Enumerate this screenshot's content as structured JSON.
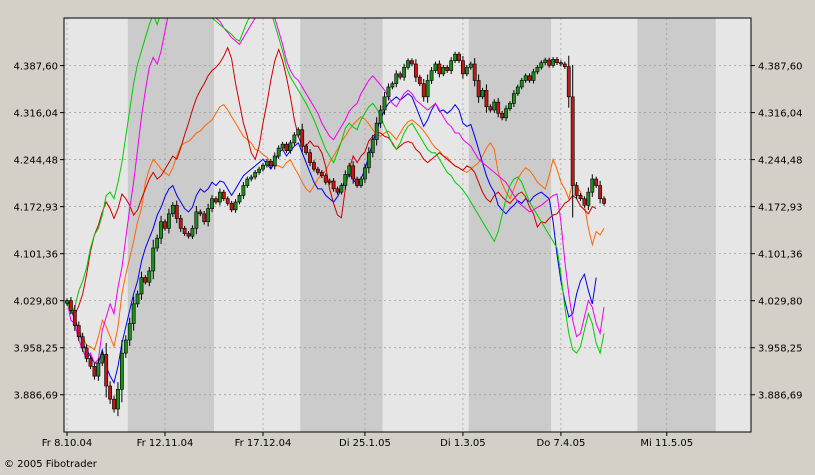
{
  "chart_data": {
    "type": "candlestick",
    "title": "",
    "copyright": "© 2005 Fibotrader",
    "ylim": [
      3830,
      4460
    ],
    "y_ticks": [
      3886.69,
      3958.25,
      4029.8,
      4101.36,
      4172.93,
      4244.48,
      4316.04,
      4387.6
    ],
    "y_tick_labels": [
      "3.886,69",
      "3.958,25",
      "4.029,80",
      "4.101,36",
      "4.172,93",
      "4.244,48",
      "4.316,04",
      "4.387,60"
    ],
    "x_range": [
      0,
      165
    ],
    "x_ticks": [
      {
        "label": "Fr 8.10.04",
        "i": 0
      },
      {
        "label": "Fr 12.11.04",
        "i": 25
      },
      {
        "label": "Fr 17.12.04",
        "i": 50
      },
      {
        "label": "Di 25.1.05",
        "i": 76
      },
      {
        "label": "Di 1.3.05",
        "i": 101
      },
      {
        "label": "Do 7.4.05",
        "i": 126
      },
      {
        "label": "Mi 11.5.05",
        "i": 153
      }
    ],
    "shaded_bands": [
      [
        16,
        38
      ],
      [
        60,
        81
      ],
      [
        103,
        124
      ],
      [
        146,
        166
      ]
    ],
    "up_color": "#1e8c1e",
    "down_color": "#c81414",
    "candles_close": [
      4030,
      4015,
      3992,
      3975,
      3958,
      3942,
      3930,
      3915,
      3935,
      3948,
      3900,
      3880,
      3865,
      3895,
      3950,
      3970,
      3995,
      4025,
      4040,
      4065,
      4058,
      4075,
      4110,
      4125,
      4150,
      4140,
      4162,
      4175,
      4155,
      4140,
      4132,
      4128,
      4140,
      4165,
      4162,
      4150,
      4170,
      4185,
      4180,
      4195,
      4185,
      4178,
      4168,
      4180,
      4190,
      4205,
      4215,
      4218,
      4225,
      4230,
      4236,
      4242,
      4235,
      4250,
      4262,
      4268,
      4258,
      4270,
      4282,
      4290,
      4265,
      4255,
      4240,
      4230,
      4225,
      4220,
      4210,
      4212,
      4200,
      4195,
      4205,
      4222,
      4235,
      4215,
      4205,
      4215,
      4232,
      4255,
      4275,
      4300,
      4320,
      4340,
      4355,
      4360,
      4375,
      4370,
      4385,
      4395,
      4390,
      4370,
      4360,
      4340,
      4365,
      4380,
      4390,
      4375,
      4385,
      4380,
      4395,
      4405,
      4395,
      4375,
      4385,
      4390,
      4365,
      4340,
      4350,
      4325,
      4320,
      4332,
      4315,
      4308,
      4322,
      4330,
      4345,
      4355,
      4365,
      4372,
      4365,
      4378,
      4385,
      4392,
      4396,
      4388,
      4397,
      4392,
      4390,
      4386,
      4340,
      4205,
      4190,
      4185,
      4175,
      4195,
      4215,
      4205,
      4185,
      4178
    ],
    "series": [
      {
        "color": "#ff6600",
        "values": [
          4030,
          4020,
          4005,
          3985,
          3975,
          3962,
          3960,
          3955,
          3975,
          4000,
          3990,
          3975,
          3960,
          3990,
          4040,
          4070,
          4095,
          4120,
          4150,
          4170,
          4210,
          4230,
          4245,
          4238,
          4230,
          4225,
          4220,
          4232,
          4250,
          4265,
          4270,
          4272,
          4278,
          4285,
          4288,
          4295,
          4300,
          4305,
          4315,
          4325,
          4328,
          4320,
          4310,
          4300,
          4290,
          4280,
          4275,
          4270,
          4260,
          4258,
          4252,
          4248,
          4240,
          4235,
          4235,
          4232,
          4240,
          4244,
          4232,
          4222,
          4210,
          4200,
          4195,
          4205,
          4215,
          4222,
          4228,
          4240,
          4250,
          4260,
          4272,
          4280,
          4290,
          4298,
          4304,
          4310,
          4306,
          4299,
          4290,
          4283,
          4280,
          4285,
          4288,
          4282,
          4275,
          4285,
          4295,
          4302,
          4305,
          4300,
          4295,
          4288,
          4280,
          4270,
          4262,
          4258,
          4250,
          4248,
          4240,
          4235,
          4232,
          4228,
          4225,
          4230,
          4235,
          4240,
          4250,
          4262,
          4270,
          4260,
          4225,
          4208,
          4195,
          4185,
          4200,
          4215,
          4225,
          4232,
          4228,
          4220,
          4210,
          4205,
          4200,
          4220,
          4245,
          4230,
          4210,
          4200,
          4185,
          4210,
          4205,
          4195,
          4175,
          4140,
          4115,
          4135,
          4130,
          4140
        ]
      },
      {
        "color": "#0000ee",
        "values": [
          4030,
          4018,
          4000,
          3985,
          3965,
          3955,
          3945,
          3935,
          3935,
          3955,
          3930,
          3915,
          3905,
          3930,
          3965,
          3990,
          4015,
          4040,
          4060,
          4090,
          4110,
          4125,
          4140,
          4160,
          4172,
          4188,
          4200,
          4205,
          4190,
          4180,
          4170,
          4165,
          4172,
          4190,
          4200,
          4195,
          4200,
          4210,
          4205,
          4212,
          4210,
          4200,
          4190,
          4200,
          4210,
          4220,
          4225,
          4230,
          4235,
          4240,
          4245,
          4238,
          4230,
          4240,
          4255,
          4260,
          4250,
          4258,
          4265,
          4270,
          4255,
          4240,
          4225,
          4210,
          4200,
          4200,
          4190,
          4185,
          4180,
          4188,
          4200,
          4215,
          4222,
          4215,
          4205,
          4215,
          4230,
          4250,
          4270,
          4290,
          4305,
          4320,
          4330,
          4335,
          4340,
          4335,
          4340,
          4345,
          4340,
          4325,
          4310,
          4295,
          4305,
          4320,
          4330,
          4318,
          4320,
          4315,
          4320,
          4328,
          4320,
          4300,
          4295,
          4298,
          4280,
          4260,
          4240,
          4220,
          4205,
          4195,
          4175,
          4168,
          4162,
          4170,
          4175,
          4182,
          4178,
          4185,
          4180,
          4188,
          4192,
          4195,
          4190,
          4185,
          4150,
          4100,
          4060,
          4030,
          4005,
          4010,
          4040,
          4060,
          4070,
          4045,
          4025,
          4065
        ]
      },
      {
        "color": "#cc0000",
        "values": [
          4030,
          4015,
          4008,
          4022,
          4040,
          4070,
          4105,
          4130,
          4145,
          4165,
          4180,
          4170,
          4155,
          4170,
          4192,
          4185,
          4175,
          4160,
          4168,
          4185,
          4200,
          4215,
          4225,
          4215,
          4220,
          4230,
          4240,
          4250,
          4245,
          4262,
          4282,
          4300,
          4320,
          4338,
          4350,
          4360,
          4372,
          4380,
          4385,
          4392,
          4402,
          4415,
          4398,
          4360,
          4330,
          4300,
          4280,
          4255,
          4245,
          4265,
          4300,
          4330,
          4365,
          4395,
          4412,
          4395,
          4370,
          4340,
          4305,
          4280,
          4265,
          4265,
          4273,
          4265,
          4265,
          4255,
          4234,
          4200,
          4178,
          4160,
          4156,
          4200,
          4230,
          4250,
          4240,
          4250,
          4256,
          4273,
          4280,
          4286,
          4285,
          4280,
          4278,
          4270,
          4260,
          4265,
          4270,
          4272,
          4270,
          4260,
          4255,
          4245,
          4240,
          4245,
          4250,
          4255,
          4250,
          4245,
          4240,
          4235,
          4232,
          4228,
          4235,
          4232,
          4225,
          4210,
          4195,
          4185,
          4180,
          4190,
          4195,
          4188,
          4182,
          4178,
          4185,
          4192,
          4195,
          4188,
          4172,
          4162,
          4142,
          4150,
          4148,
          4155,
          4160,
          4162,
          4170,
          4178,
          4182,
          4190,
          4185,
          4174,
          4168,
          4162,
          4173,
          4170
        ]
      },
      {
        "color": "#ee00ee",
        "values": [
          4030,
          4000,
          3995,
          3970,
          3955,
          3940,
          3950,
          3935,
          3940,
          3985,
          4005,
          4025,
          4010,
          4050,
          4080,
          4125,
          4170,
          4210,
          4260,
          4310,
          4350,
          4385,
          4400,
          4390,
          4410,
          4440,
          4470,
          4495,
          4505,
          4500,
          4515,
          4510,
          4490,
          4475,
          4478,
          4470,
          4465,
          4472,
          4460,
          4455,
          4445,
          4438,
          4430,
          4425,
          4420,
          4430,
          4440,
          4450,
          4460,
          4470,
          4478,
          4480,
          4475,
          4460,
          4440,
          4420,
          4395,
          4380,
          4370,
          4365,
          4355,
          4345,
          4335,
          4325,
          4315,
          4300,
          4290,
          4280,
          4275,
          4285,
          4295,
          4305,
          4318,
          4325,
          4330,
          4345,
          4355,
          4365,
          4372,
          4365,
          4358,
          4350,
          4340,
          4330,
          4325,
          4335,
          4345,
          4350,
          4345,
          4335,
          4330,
          4325,
          4320,
          4325,
          4330,
          4320,
          4310,
          4300,
          4295,
          4285,
          4285,
          4275,
          4270,
          4265,
          4255,
          4245,
          4240,
          4235,
          4230,
          4225,
          4220,
          4215,
          4210,
          4200,
          4190,
          4180,
          4175,
          4170,
          4165,
          4168,
          4172,
          4175,
          4180,
          4185,
          4190,
          4192,
          4150,
          4090,
          4040,
          4000,
          3975,
          3980,
          4005,
          4030,
          4020,
          3995,
          3980,
          4020
        ]
      },
      {
        "color": "#00cc00",
        "values": [
          4030,
          4010,
          4020,
          4045,
          4060,
          4080,
          4110,
          4130,
          4140,
          4160,
          4190,
          4195,
          4185,
          4210,
          4240,
          4280,
          4320,
          4360,
          4390,
          4410,
          4430,
          4450,
          4465,
          4450,
          4470,
          4500,
          4520,
          4530,
          4525,
          4510,
          4500,
          4490,
          4480,
          4470,
          4465,
          4472,
          4468,
          4460,
          4455,
          4450,
          4445,
          4440,
          4435,
          4428,
          4425,
          4440,
          4455,
          4465,
          4475,
          4485,
          4490,
          4485,
          4470,
          4450,
          4430,
          4410,
          4385,
          4370,
          4360,
          4350,
          4340,
          4330,
          4318,
          4305,
          4290,
          4275,
          4260,
          4250,
          4240,
          4255,
          4272,
          4292,
          4300,
          4294,
          4290,
          4305,
          4315,
          4325,
          4330,
          4322,
          4310,
          4295,
          4282,
          4268,
          4260,
          4270,
          4285,
          4295,
          4300,
          4290,
          4280,
          4270,
          4260,
          4255,
          4255,
          4245,
          4235,
          4225,
          4220,
          4210,
          4205,
          4198,
          4190,
          4180,
          4170,
          4160,
          4150,
          4140,
          4130,
          4120,
          4135,
          4160,
          4185,
          4205,
          4215,
          4218,
          4210,
          4195,
          4180,
          4170,
          4160,
          4150,
          4140,
          4130,
          4120,
          4110,
          4070,
          4020,
          3980,
          3955,
          3950,
          3960,
          3985,
          4010,
          3995,
          3965,
          3950,
          3980
        ]
      }
    ]
  }
}
